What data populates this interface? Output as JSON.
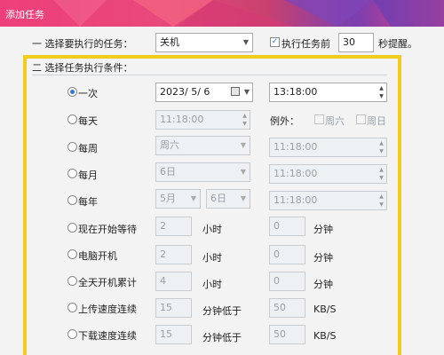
{
  "window": {
    "title": "添加任务"
  },
  "task": {
    "label": "一 选择要执行的任务：",
    "select_value": "关机",
    "execute_before_label": "执行任务前",
    "execute_before_checked": true,
    "seconds_value": "30",
    "seconds_suffix": "秒提醒。"
  },
  "conditions": {
    "label": "二 选择任务执行条件：",
    "once": {
      "label": "一次",
      "date": "2023/  5/  6",
      "time": "13:18:00"
    },
    "daily": {
      "label": "每天",
      "time": "11:18:00",
      "except_label": "例外：",
      "sat": "周六",
      "sun": "周日"
    },
    "weekly": {
      "label": "每周",
      "day": "周六",
      "time": "11:18:00"
    },
    "monthly": {
      "label": "每月",
      "day": "6日",
      "time": "11:18:00"
    },
    "yearly": {
      "label": "每年",
      "month": "5月",
      "day": "6日",
      "time": "11:18:00"
    },
    "wait": {
      "label": "现在开始等待",
      "hours": "2",
      "hours_unit": "小时",
      "minutes": "0",
      "minutes_unit": "分钟"
    },
    "boot": {
      "label": "电脑开机",
      "hours": "2",
      "hours_unit": "小时",
      "minutes": "0",
      "minutes_unit": "分钟"
    },
    "uptime": {
      "label": "全天开机累计",
      "hours": "4",
      "hours_unit": "小时",
      "minutes": "0",
      "minutes_unit": "分钟"
    },
    "upload": {
      "label": "上传速度连续",
      "minutes": "15",
      "minutes_unit": "分钟低于",
      "speed": "50",
      "speed_unit": "KB/S"
    },
    "download": {
      "label": "下载速度连续",
      "minutes": "15",
      "minutes_unit": "分钟低于",
      "speed": "50",
      "speed_unit": "KB/S"
    }
  },
  "colors": {
    "accent": "#2a7ad5",
    "highlight_frame": "#f4cc1b",
    "title_pink": "#ee3f7a"
  }
}
